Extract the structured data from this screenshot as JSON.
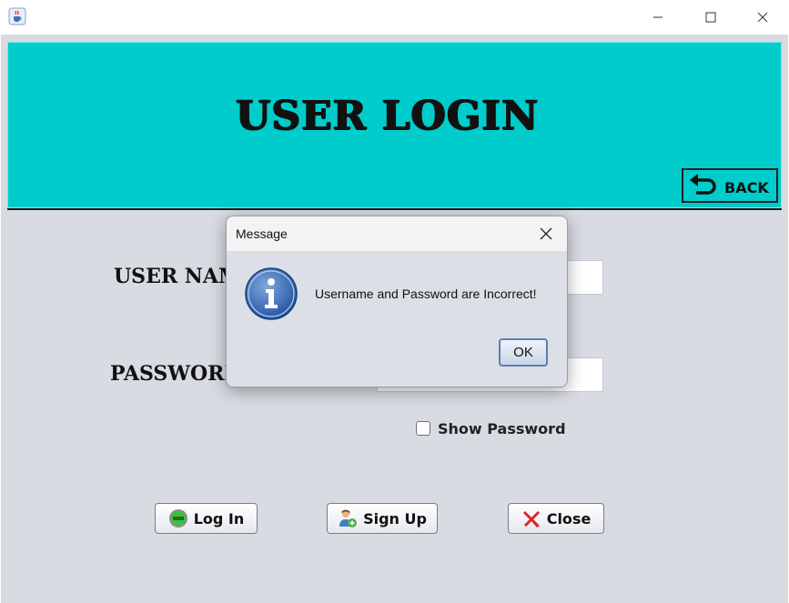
{
  "window": {
    "title": ""
  },
  "header": {
    "title": "USER LOGIN",
    "back_label": "BACK",
    "background_color": "#00cccc"
  },
  "form": {
    "username_label": "USER NAME",
    "username_value": "",
    "password_label": "PASSWORD",
    "password_value": "",
    "show_password_label": "Show Password",
    "show_password_checked": false
  },
  "buttons": {
    "login_label": "Log In",
    "signup_label": "Sign Up",
    "close_label": "Close"
  },
  "dialog": {
    "title": "Message",
    "message": "Username and Password are Incorrect!",
    "ok_label": "OK",
    "icon": "info-icon"
  },
  "icons": {
    "app": "java-cup-icon",
    "minimize": "minimize-icon",
    "maximize": "maximize-icon",
    "close": "close-icon",
    "back": "back-arrow-icon",
    "login": "green-circle-icon",
    "signup": "add-user-icon",
    "close_button": "red-x-icon"
  }
}
